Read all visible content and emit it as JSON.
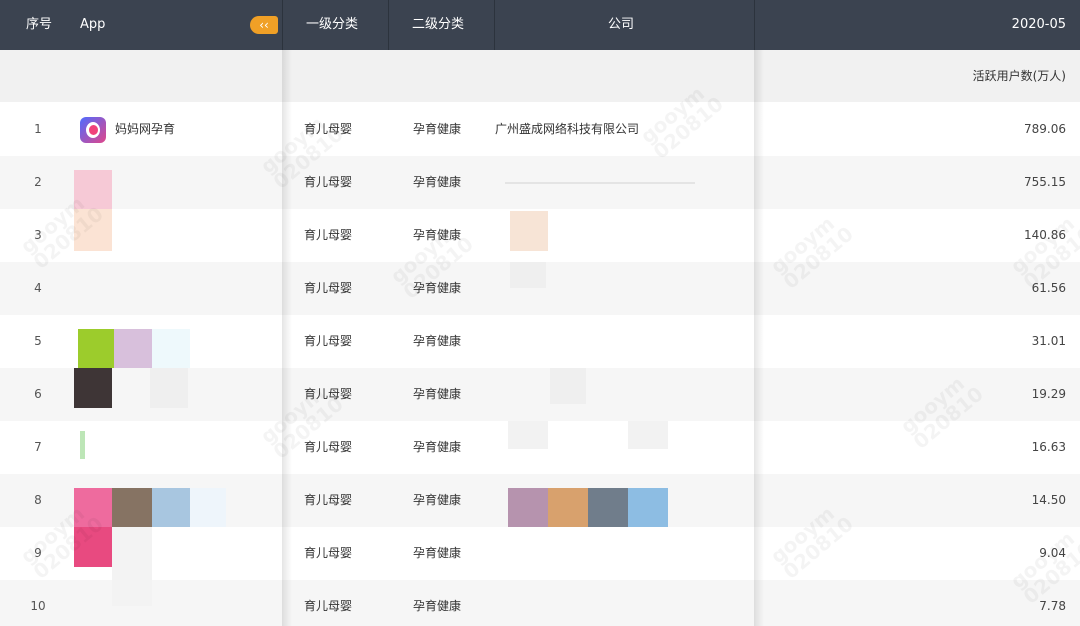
{
  "header": {
    "col_index": "序号",
    "col_app": "App",
    "collapse_glyph": "‹‹",
    "col_category1": "一级分类",
    "col_category2": "二级分类",
    "col_company": "公司",
    "col_period": "2020-05"
  },
  "subheader": {
    "metric_label": "活跃用户数(万人)"
  },
  "rows": [
    {
      "index": "1",
      "app": "妈妈网孕育",
      "category1": "育儿母婴",
      "category2": "孕育健康",
      "company": "广州盛成网络科技有限公司",
      "value": "789.06"
    },
    {
      "index": "2",
      "app": "",
      "category1": "育儿母婴",
      "category2": "孕育健康",
      "company": "",
      "value": "755.15"
    },
    {
      "index": "3",
      "app": "",
      "category1": "育儿母婴",
      "category2": "孕育健康",
      "company": "",
      "value": "140.86"
    },
    {
      "index": "4",
      "app": "",
      "category1": "育儿母婴",
      "category2": "孕育健康",
      "company": "",
      "value": "61.56"
    },
    {
      "index": "5",
      "app": "",
      "category1": "育儿母婴",
      "category2": "孕育健康",
      "company": "",
      "value": "31.01"
    },
    {
      "index": "6",
      "app": "",
      "category1": "育儿母婴",
      "category2": "孕育健康",
      "company": "",
      "value": "19.29"
    },
    {
      "index": "7",
      "app": "",
      "category1": "育儿母婴",
      "category2": "孕育健康",
      "company": "",
      "value": "16.63"
    },
    {
      "index": "8",
      "app": "",
      "category1": "育儿母婴",
      "category2": "孕育健康",
      "company": "",
      "value": "14.50"
    },
    {
      "index": "9",
      "app": "",
      "category1": "育儿母婴",
      "category2": "孕育健康",
      "company": "",
      "value": "9.04"
    },
    {
      "index": "10",
      "app": "",
      "category1": "育儿母婴",
      "category2": "孕育健康",
      "company": "",
      "value": "7.78"
    }
  ],
  "watermark": {
    "line1": "gooym",
    "line2": "020810"
  },
  "colors": {
    "header_bg": "#3b4350",
    "collapse_button": "#f0a026",
    "subheader_bg": "#f1f1f1",
    "row_alt_bg": "#f6f6f6"
  }
}
